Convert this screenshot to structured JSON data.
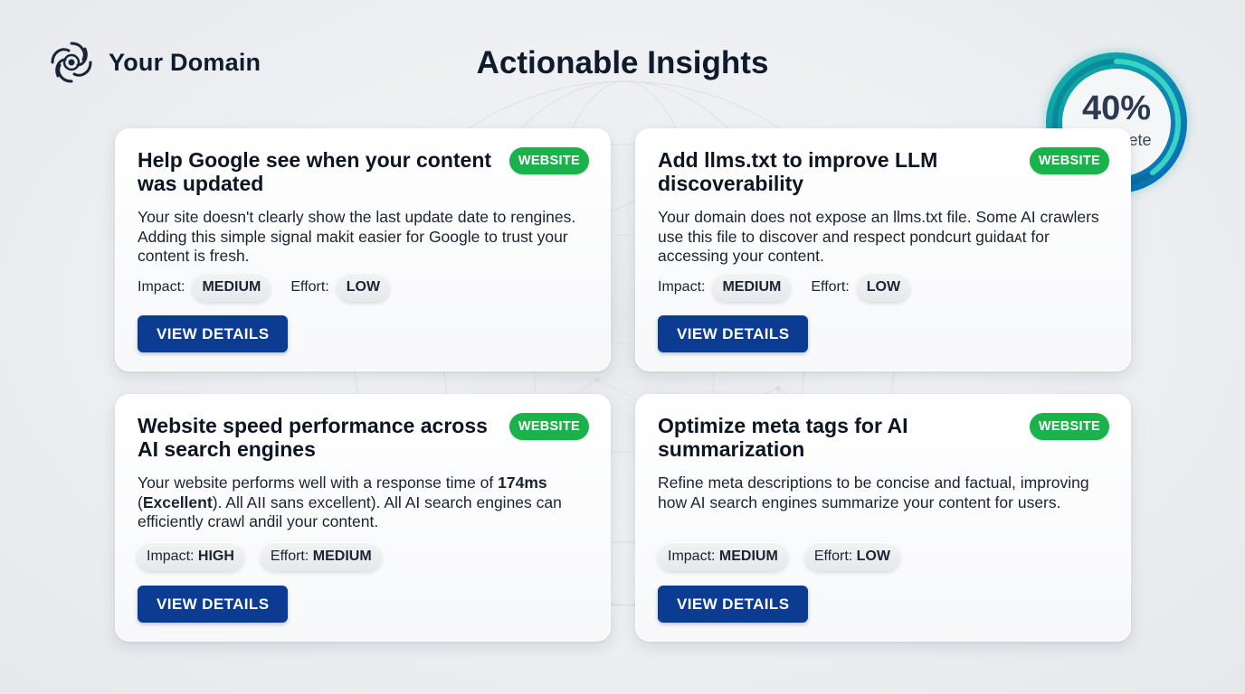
{
  "brand": {
    "name": "Your Domain"
  },
  "page": {
    "title": "Actionable Insights"
  },
  "progress": {
    "value": 0.4,
    "percent_label": "40%",
    "label": "Complete",
    "color": "#0aa6a6"
  },
  "colors": {
    "badge": "#1ab24a",
    "button": "#0b3c91"
  },
  "cards": [
    {
      "title": "Help Google see when your content was updated",
      "badge": "WEBSITE",
      "desc_parts": [
        "Your site doesn't clearly show the last update date to rengines. Adding this simple signal makit easier for Google to trust your content is fresh."
      ],
      "impact_label": "Impact:",
      "impact_value": "MEDIUM",
      "effort_label": "Effort:",
      "effort_value": "LOW",
      "button": "VIEW DETAILS"
    },
    {
      "title": "Add llms.txt to improve LLM discoverability",
      "badge": "WEBSITE",
      "desc_parts": [
        "Your domain does not expose an llms.txt file. Some AI crawlers use this file to discover and respect pondᴄurt guidaᴀt for accessing your content."
      ],
      "impact_label": "Impact:",
      "impact_value": "MEDIUM",
      "effort_label": "Effort:",
      "effort_value": "LOW",
      "button": "VIEW DETAILS"
    },
    {
      "title": "Website speed performance across AI search engines",
      "badge": "WEBSITE",
      "desc_parts": [
        "Your website performs well with a response time of ",
        "174ms",
        " (",
        "Excellent",
        "). All AII sans excellent). All AI search engines can efficiently crawl anḋil your content."
      ],
      "impact_label": "Impact:",
      "impact_value": "HIGH",
      "effort_label": "Effort:",
      "effort_value": "MEDIUM",
      "button": "VIEW DETAILS"
    },
    {
      "title": "Optimize meta tags for AI summarization",
      "badge": "WEBSITE",
      "desc_parts": [
        "Refine meta descriptions to be concise and factual, improving how AI search engines summarize your content for users."
      ],
      "impact_label": "Impact:",
      "impact_value": "MEDIUM",
      "effort_label": "Effort:",
      "effort_value": "LOW",
      "button": "VIEW DETAILS"
    }
  ]
}
